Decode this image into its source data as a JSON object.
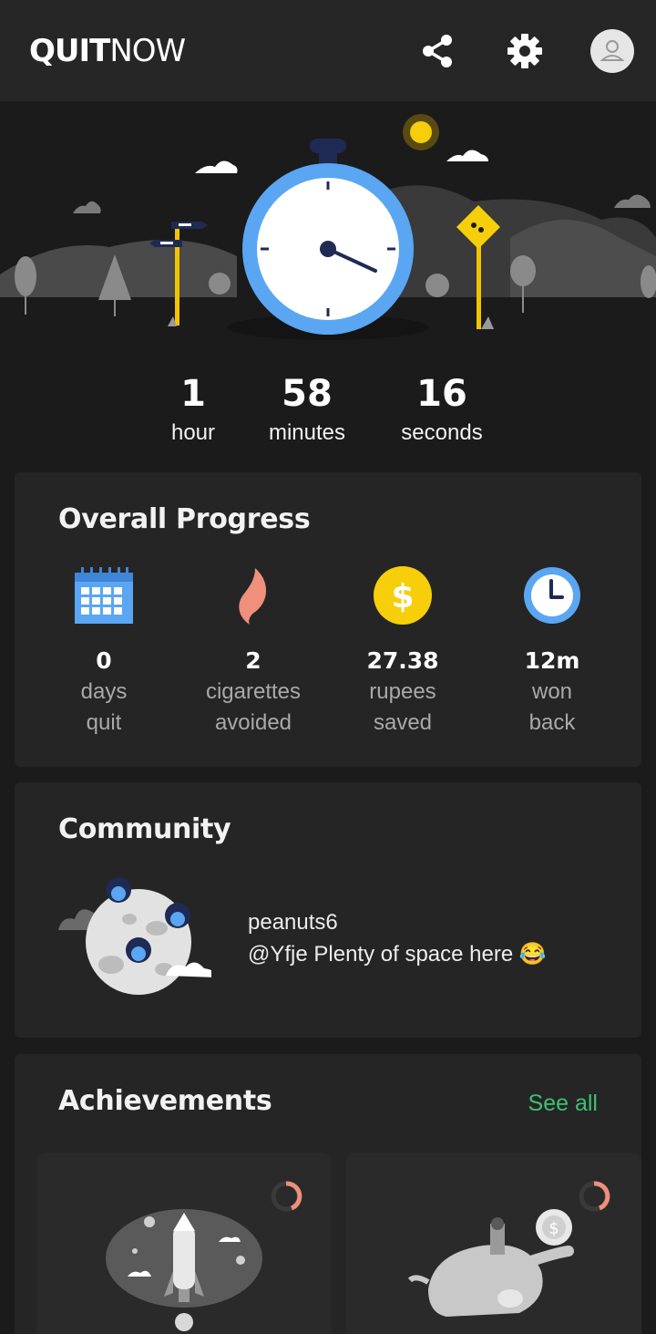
{
  "app": {
    "logo_bold": "QUIT",
    "logo_light": "NOW"
  },
  "toolbar": {
    "share_icon": "share-icon",
    "settings_icon": "gear-icon",
    "avatar_icon": "avatar-icon"
  },
  "timer": {
    "hours": {
      "value": "1",
      "label": "hour"
    },
    "minutes": {
      "value": "58",
      "label": "minutes"
    },
    "seconds": {
      "value": "16",
      "label": "seconds"
    }
  },
  "progress": {
    "title": "Overall Progress",
    "stats": [
      {
        "icon": "calendar-icon",
        "value": "0",
        "line1": "days",
        "line2": "quit"
      },
      {
        "icon": "flame-icon",
        "value": "2",
        "line1": "cigarettes",
        "line2": "avoided"
      },
      {
        "icon": "dollar-coin-icon",
        "value": "27.38",
        "line1": "rupees",
        "line2": "saved"
      },
      {
        "icon": "clock-icon",
        "value": "12m",
        "line1": "won",
        "line2": "back"
      }
    ]
  },
  "community": {
    "title": "Community",
    "username": "peanuts6",
    "message": "@Yfje Plenty of space here 😂"
  },
  "achievements": {
    "title": "Achievements",
    "see_all": "See all"
  },
  "colors": {
    "accent_green": "#3fbf74",
    "clock_blue": "#5aa6f2",
    "coin_yellow": "#f6cf0a",
    "flame_salmon": "#ef8f7c",
    "progress_ring": "#ef8f7c"
  }
}
